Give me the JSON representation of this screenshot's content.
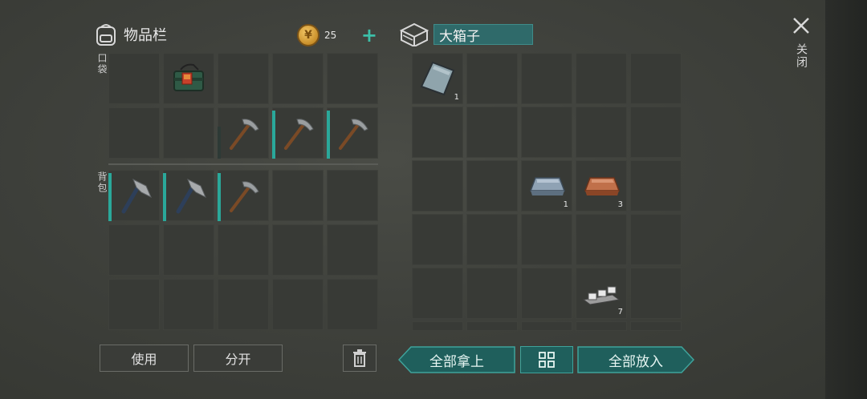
{
  "inventory": {
    "title": "物品栏",
    "coin_count": "25",
    "plus_label": "+",
    "pocket_label": "口袋",
    "backpack_label": "背包",
    "use_label": "使用",
    "split_label": "分开"
  },
  "container": {
    "title": "大箱子",
    "take_all_label": "全部拿上",
    "put_all_label": "全部放入",
    "items": {
      "glass_qty": "1",
      "iron_qty": "1",
      "copper_qty": "3",
      "nails_qty": "7"
    }
  },
  "close": {
    "label": "关闭"
  },
  "colors": {
    "accent": "#2aa89a",
    "slot": "#383a36",
    "teal_button": "#1f5f5c"
  }
}
